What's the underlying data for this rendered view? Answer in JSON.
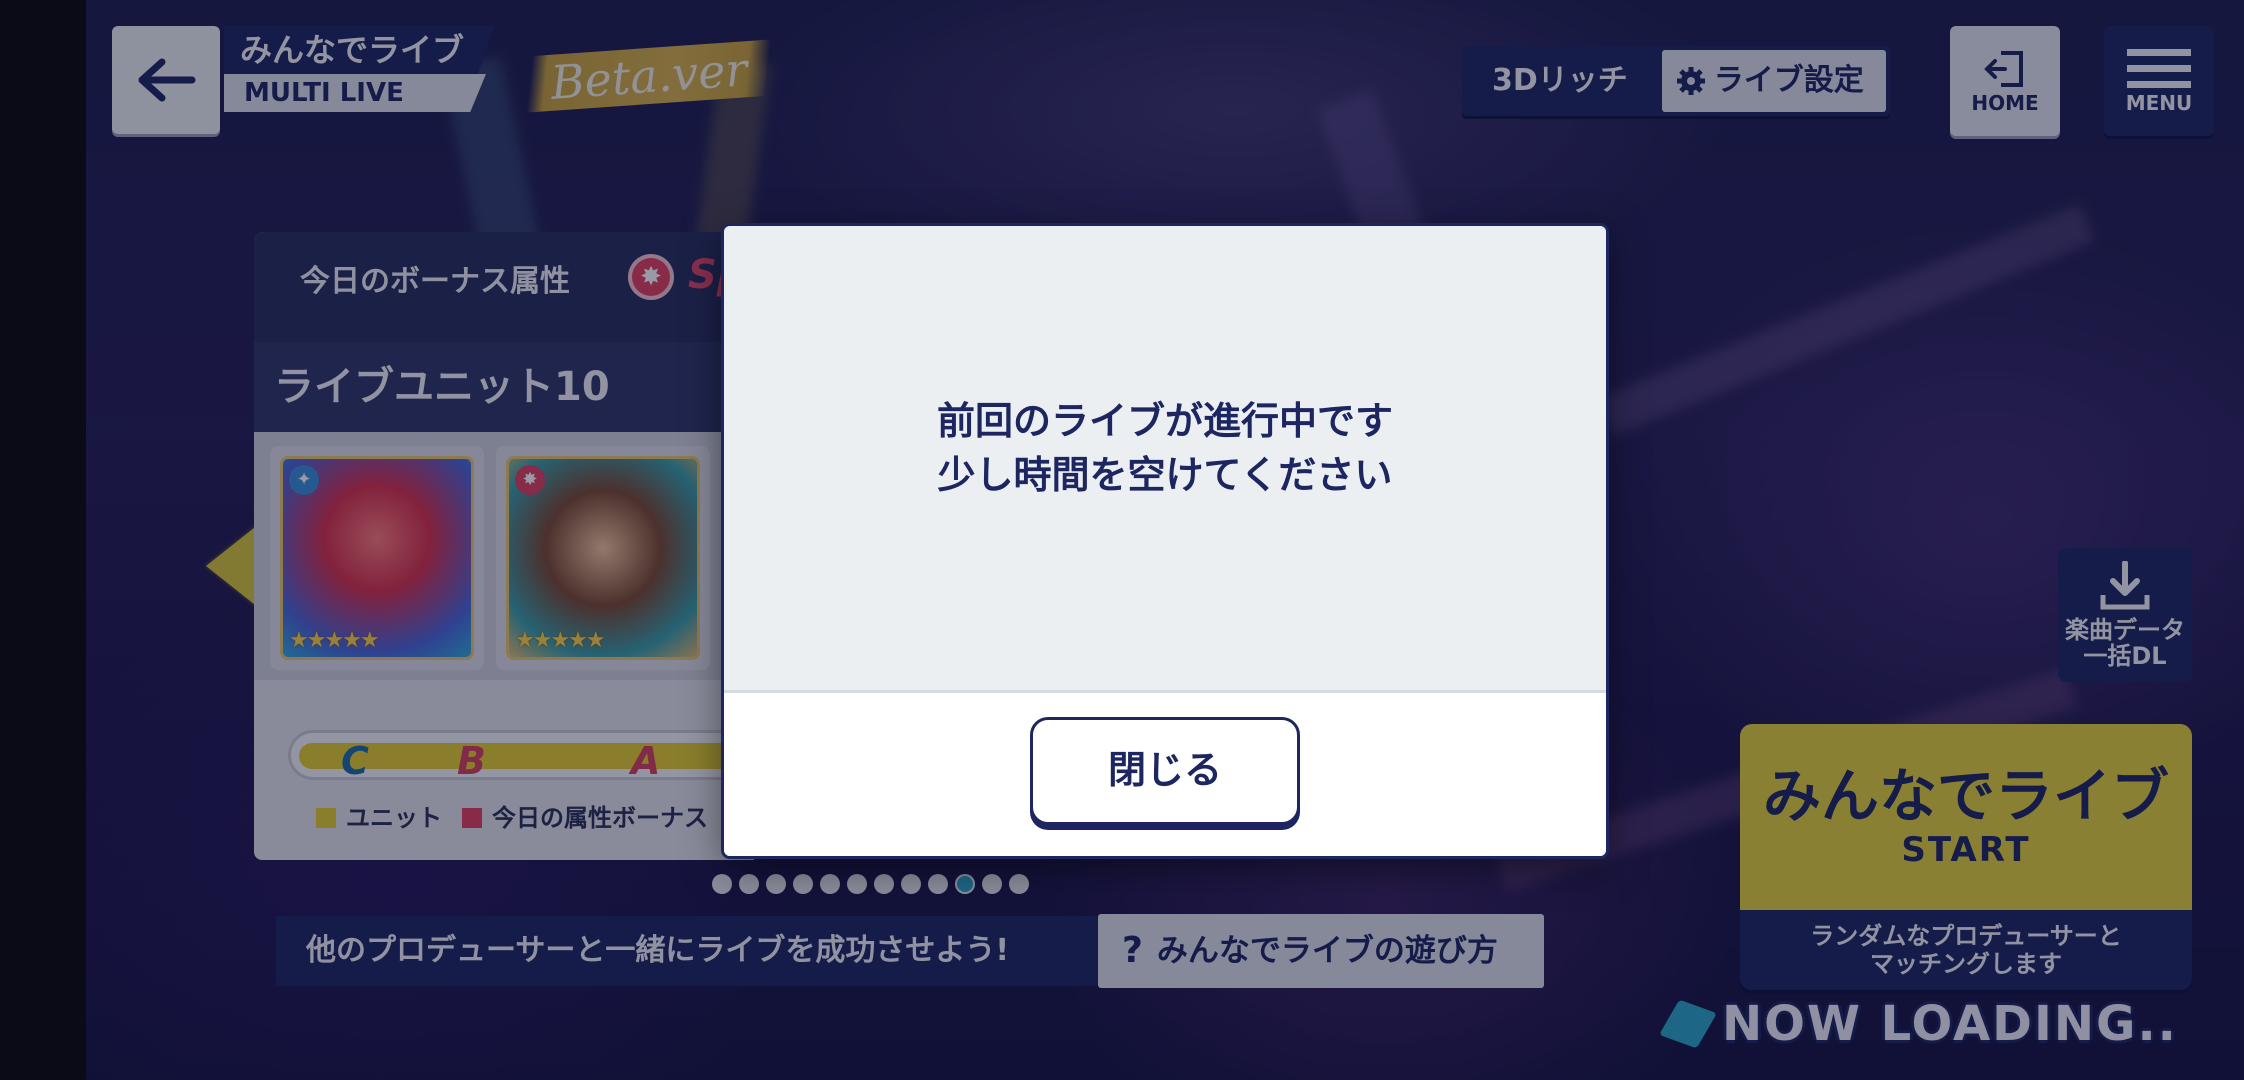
{
  "header": {
    "title": "みんなでライブ",
    "subtitle": "MULTI LIVE",
    "beta_label": "Beta.ver",
    "rich_label": "3Dリッチ",
    "live_settings_label": "ライブ設定",
    "home_label": "HOME",
    "menu_label": "MENU"
  },
  "panel": {
    "bonus_label": "今日のボーナス属性",
    "bonus_type_partial": "Sp",
    "unit_name": "ライブユニット10",
    "cards": [
      {
        "attribute_icon": "star-burst-icon",
        "stars": 5
      },
      {
        "attribute_icon": "sun-burst-icon",
        "stars": 5
      }
    ],
    "ranks": [
      "C",
      "B",
      "A"
    ],
    "legend_unit": "ユニット",
    "legend_bonus": "今日の属性ボーナス"
  },
  "pagination": {
    "count": 12,
    "active_index": 9
  },
  "hint_text": "他のプロデューサーと一緒にライブを成功させよう!",
  "howto_label": "みんなでライブの遊び方",
  "download": {
    "line1": "楽曲データ",
    "line2": "一括DL"
  },
  "start_card": {
    "title": "みんなでライブ",
    "sub": "START",
    "desc_line1": "ランダムなプロデューサーと",
    "desc_line2": "マッチングします"
  },
  "loading_text": "NOW LOADING..",
  "dialog": {
    "line1": "前回のライブが進行中です",
    "line2": "少し時間を空けてください",
    "close_label": "閉じる"
  },
  "colors": {
    "navy": "#1d2660",
    "yellow": "#e5d33a",
    "accent_blue": "#2aa6c9",
    "bonus_red": "#e0405e"
  }
}
